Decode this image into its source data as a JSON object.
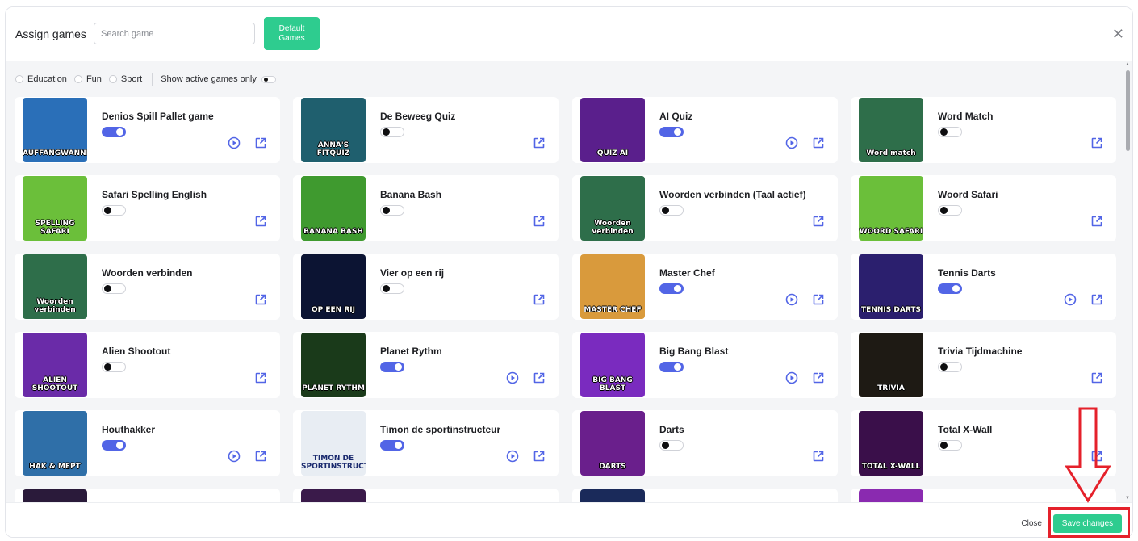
{
  "header": {
    "title": "Assign games",
    "search_placeholder": "Search game",
    "default_games_button": "Default Games"
  },
  "filters": {
    "categories": [
      "Education",
      "Fun",
      "Sport"
    ],
    "active_only_label": "Show active games only",
    "active_only_enabled": false
  },
  "colors": {
    "accent": "#5265e6",
    "primary_button": "#2ecc8f",
    "annotation": "#e5212b"
  },
  "games": [
    {
      "name": "Denios Spill Pallet game",
      "active": true,
      "has_play": true,
      "thumb_text": "AUFFANGWANNE",
      "thumb_bg": "#2a6fb8"
    },
    {
      "name": "De Beweeg Quiz",
      "active": false,
      "has_play": false,
      "thumb_text": "ANNA'S FITQUIZ",
      "thumb_bg": "#1f5f6e"
    },
    {
      "name": "AI Quiz",
      "active": true,
      "has_play": true,
      "thumb_text": "QUIZ AI",
      "thumb_bg": "#5a1f8c"
    },
    {
      "name": "Word Match",
      "active": false,
      "has_play": false,
      "thumb_text": "Word match",
      "thumb_bg": "#2e6e4a"
    },
    {
      "name": "Safari Spelling English",
      "active": false,
      "has_play": false,
      "thumb_text": "SPELLING SAFARI",
      "thumb_bg": "#6bbf3a"
    },
    {
      "name": "Banana Bash",
      "active": false,
      "has_play": false,
      "thumb_text": "BANANA BASH",
      "thumb_bg": "#3f9a2f"
    },
    {
      "name": "Woorden verbinden (Taal actief)",
      "active": false,
      "has_play": false,
      "thumb_text": "Woorden verbinden",
      "thumb_bg": "#2e6e4a"
    },
    {
      "name": "Woord Safari",
      "active": false,
      "has_play": false,
      "thumb_text": "WOORD SAFARI",
      "thumb_bg": "#6bbf3a"
    },
    {
      "name": "Woorden verbinden",
      "active": false,
      "has_play": false,
      "thumb_text": "Woorden verbinden",
      "thumb_bg": "#2e6e4a"
    },
    {
      "name": "Vier op een rij",
      "active": false,
      "has_play": false,
      "thumb_text": "OP EEN RIJ",
      "thumb_bg": "#0c1433"
    },
    {
      "name": "Master Chef",
      "active": true,
      "has_play": true,
      "thumb_text": "MASTER CHEF",
      "thumb_bg": "#d99a3c"
    },
    {
      "name": "Tennis Darts",
      "active": true,
      "has_play": true,
      "thumb_text": "TENNIS DARTS",
      "thumb_bg": "#2b1f6e"
    },
    {
      "name": "Alien Shootout",
      "active": false,
      "has_play": false,
      "thumb_text": "ALIEN SHOOTOUT",
      "thumb_bg": "#6a2ba8"
    },
    {
      "name": "Planet Rythm",
      "active": true,
      "has_play": true,
      "thumb_text": "PLANET RYTHM",
      "thumb_bg": "#1a3a1a"
    },
    {
      "name": "Big Bang Blast",
      "active": true,
      "has_play": true,
      "thumb_text": "BIG BANG BLAST",
      "thumb_bg": "#7a2bbf"
    },
    {
      "name": "Trivia Tijdmachine",
      "active": false,
      "has_play": false,
      "thumb_text": "TRIVIA",
      "thumb_bg": "#1e1a14"
    },
    {
      "name": "Houthakker",
      "active": true,
      "has_play": true,
      "thumb_text": "HAK & MEPT",
      "thumb_bg": "#2f6fa8"
    },
    {
      "name": "Timon de sportinstructeur",
      "active": true,
      "has_play": true,
      "thumb_text": "TIMON DE SPORTINSTRUCTEUR",
      "thumb_bg": "#e8edf3"
    },
    {
      "name": "Darts",
      "active": false,
      "has_play": false,
      "thumb_text": "DARTS",
      "thumb_bg": "#6a1f8c"
    },
    {
      "name": "Total X-Wall",
      "active": false,
      "has_play": false,
      "thumb_text": "TOTAL X-WALL",
      "thumb_bg": "#3a0f4a"
    }
  ],
  "partial_row_thumbs": [
    "#2a1a3a",
    "#3a1a4a",
    "#1a2a5a",
    "#8a2ab0"
  ],
  "footer": {
    "close_label": "Close",
    "save_label": "Save changes"
  }
}
